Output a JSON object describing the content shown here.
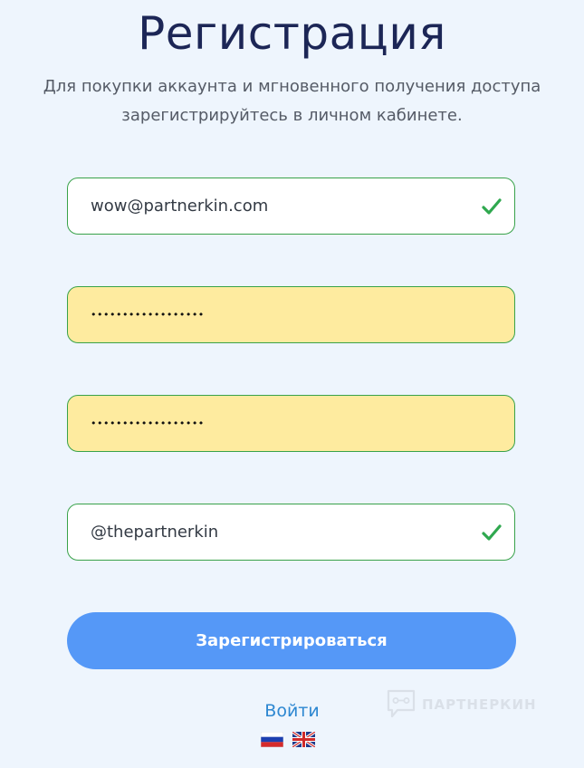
{
  "page": {
    "title": "Регистрация",
    "subtitle_line1": "Для покупки аккаунта и мгновенного получения доступа",
    "subtitle_line2": "зарегистрируйтесь в личном кабинете."
  },
  "form": {
    "email": {
      "value": "wow@partnerkin.com",
      "valid": true
    },
    "password": {
      "value": "••••••••••••••••••",
      "autofilled": true
    },
    "password_confirm": {
      "value": "••••••••••••••••••",
      "autofilled": true
    },
    "telegram": {
      "value": "@thepartnerkin",
      "valid": true
    },
    "submit_label": "Зарегистрироваться"
  },
  "footer": {
    "login_label": "Войти",
    "languages": [
      {
        "code": "ru",
        "icon": "russia-flag-icon"
      },
      {
        "code": "en",
        "icon": "uk-flag-icon"
      }
    ],
    "watermark_text": "ПАРТНЕРКИН"
  },
  "colors": {
    "background": "#eef5fd",
    "title": "#1c2656",
    "valid_border": "#39a24a",
    "autofill_bg": "#feeb9f",
    "button": "#5598f7",
    "link": "#2d87d1"
  }
}
